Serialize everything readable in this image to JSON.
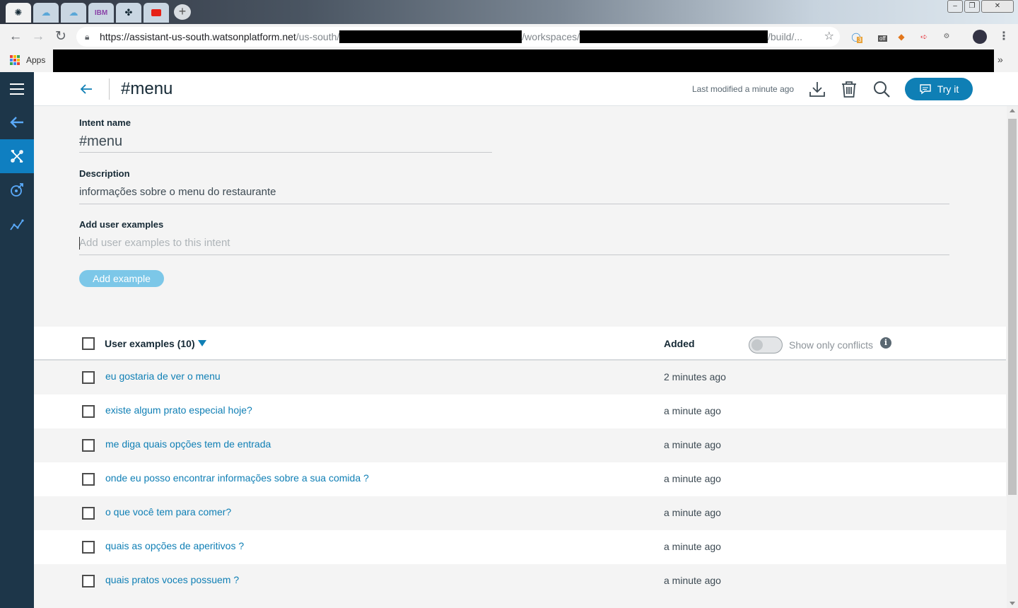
{
  "browser": {
    "url_host": "https://assistant-us-south.watsonplatform.net",
    "url_seg1": "/us-south/",
    "url_seg2": "/workspaces/",
    "url_seg3": "/build/...",
    "bookmarks_apps_label": "Apps",
    "ext_badge_count": "3",
    "ext_badge_off": "off"
  },
  "header": {
    "title": "#menu",
    "last_modified": "Last modified a minute ago",
    "try_it_label": "Try it"
  },
  "form": {
    "intent_name_label": "Intent name",
    "intent_name_value": "#menu",
    "description_label": "Description",
    "description_value": "informações sobre o menu do restaurante",
    "add_examples_label": "Add user examples",
    "add_examples_placeholder": "Add user examples to this intent",
    "add_example_button": "Add example"
  },
  "table": {
    "examples_header": "User examples (10)",
    "added_header": "Added",
    "conflicts_toggle_label": "Show only conflicts",
    "info_glyph": "i",
    "rows": [
      {
        "text": "eu gostaria de ver o menu",
        "added": "2 minutes ago"
      },
      {
        "text": "existe algum prato especial hoje?",
        "added": "a minute ago"
      },
      {
        "text": "me diga quais opções tem de entrada",
        "added": "a minute ago"
      },
      {
        "text": "onde eu posso encontrar informações sobre a sua comida ?",
        "added": "a minute ago"
      },
      {
        "text": "o que você tem para comer?",
        "added": "a minute ago"
      },
      {
        "text": "quais as opções de aperitivos ?",
        "added": "a minute ago"
      },
      {
        "text": "quais pratos voces possuem ?",
        "added": "a minute ago"
      }
    ]
  },
  "colors": {
    "rail": "#1d3649",
    "accent": "#0f7fb5",
    "active_rail": "#0f7fc1",
    "link": "#0f7fb5"
  },
  "icons": {
    "rail": [
      "hamburger-menu-icon",
      "back-arrow-icon",
      "build-tools-icon",
      "improve-icon",
      "analytics-icon"
    ],
    "header": [
      "download-icon",
      "trash-icon",
      "search-icon",
      "chat-bubble-icon"
    ]
  }
}
